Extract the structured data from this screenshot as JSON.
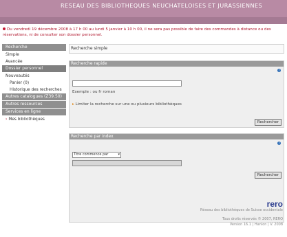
{
  "header": {
    "title": "RESEAU DES BIBLIOTHEQUES NEUCHATELOISES ET JURASSIENNES"
  },
  "alert": {
    "text": "Du vendredi 19 décembre 2008 à 17 h 00 au lundi 5 janvier à 10 h 00, il ne sera pas possible de faire des commandes à distance ou des réservations, ni de consulter son dossier personnel."
  },
  "sidebar": {
    "recherche": "Recherche",
    "simple": "Simple",
    "avancee": "Avancée",
    "dossier": "Dossier personnel",
    "nouveautes": "Nouveautés",
    "panier": "Panier (0)",
    "historique": "Historique des recherches",
    "autres_catalogues": "Autres catalogues (Z39.50)",
    "autres_ressources": "Autres ressources",
    "services": "Services en ligne",
    "mes_bibliotheques": "Mes bibliothèques"
  },
  "main": {
    "breadcrumb": "Recherche simple",
    "panel1": {
      "title": "Recherche rapide",
      "input_value": "",
      "example": "Exemple : ou fr roman",
      "link": "Limiter la recherche sur une ou plusieurs bibliothèques",
      "button": "Rechercher"
    },
    "panel2": {
      "title": "Recherche par index",
      "select_value": "Titre commence par",
      "input_value": "",
      "button": "Rechercher"
    }
  },
  "footer": {
    "logo": "rero",
    "logo_sub": "Réseau des bibliothèques de Suisse occidentale",
    "line1": "Tous droits réservés © 2007, RERO",
    "line2": "Version 16.1 | Hanlon | V. 2008"
  },
  "colors": {
    "header": "#b88aa4",
    "alert": "#b0152c",
    "sidebar_head": "#8f8f8f"
  }
}
